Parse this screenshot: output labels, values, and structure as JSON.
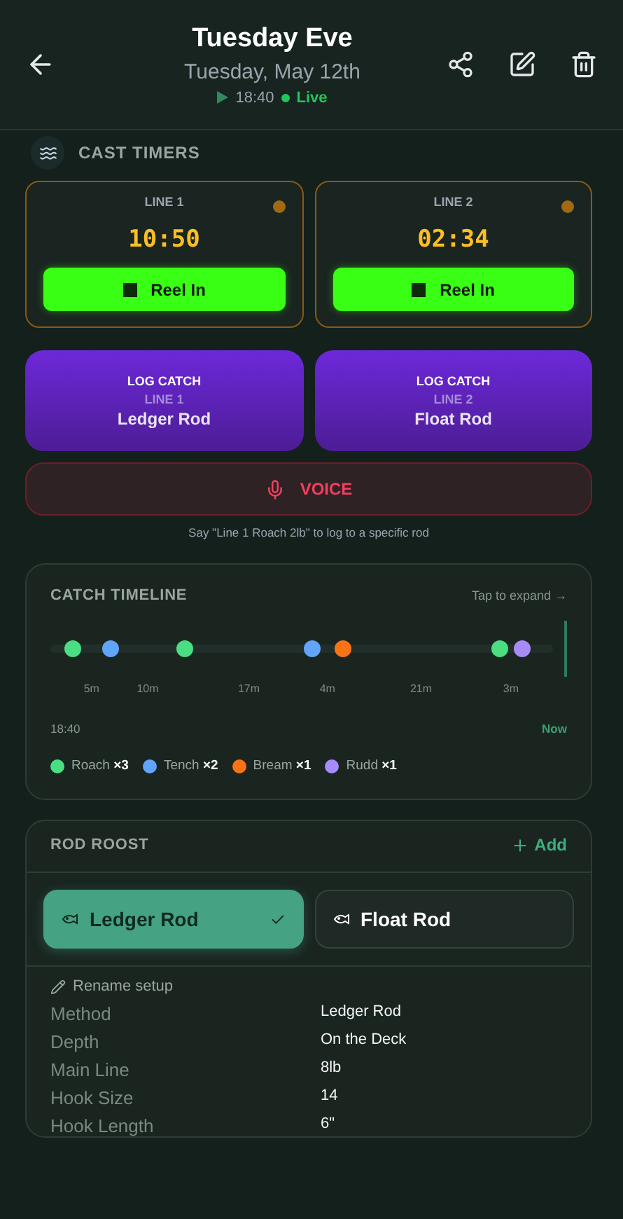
{
  "header": {
    "title": "Tuesday Eve",
    "date": "Tuesday, May 12th",
    "start_time": "18:40",
    "status": "Live",
    "live": true
  },
  "cast_timers": {
    "title": "CAST TIMERS",
    "timers": [
      {
        "line": "LINE 1",
        "time": "10:50",
        "running": true,
        "button": "Reel In"
      },
      {
        "line": "LINE 2",
        "time": "02:34",
        "running": true,
        "button": "Reel In"
      }
    ]
  },
  "log_buttons": [
    {
      "action": "LOG CATCH",
      "line": "LINE 1",
      "rod": "Ledger Rod"
    },
    {
      "action": "LOG CATCH",
      "line": "LINE 2",
      "rod": "Float Rod"
    }
  ],
  "voice": {
    "label": "VOICE",
    "hint": "Say \"Line 1 Roach 2lb\" to log to a specific rod"
  },
  "timeline": {
    "title": "CATCH TIMELINE",
    "expand": "Tap to expand →",
    "start": "18:40",
    "end": "Now",
    "catches": [
      {
        "color": "#4ade80"
      },
      {
        "color": "#60a5fa"
      },
      {
        "color": "#4ade80"
      },
      {
        "color": "#60a5fa"
      },
      {
        "color": "#f97316"
      },
      {
        "color": "#4ade80"
      },
      {
        "color": "#a78bfa"
      }
    ],
    "gaps": [
      "5m",
      "10m",
      "17m",
      "4m",
      "21m",
      "3m"
    ],
    "legend": [
      {
        "name": "Roach",
        "count": "×3",
        "color": "#4ade80"
      },
      {
        "name": "Tench",
        "count": "×2",
        "color": "#60a5fa"
      },
      {
        "name": "Bream",
        "count": "×1",
        "color": "#f97316"
      },
      {
        "name": "Rudd",
        "count": "×1",
        "color": "#a78bfa"
      }
    ]
  },
  "rod_roost": {
    "title": "ROD ROOST",
    "add": "Add",
    "rods": [
      {
        "name": "Ledger Rod",
        "selected": true
      },
      {
        "name": "Float Rod",
        "selected": false
      }
    ],
    "rename": "Rename setup",
    "details": [
      {
        "label": "Method",
        "value": "Ledger Rod"
      },
      {
        "label": "Depth",
        "value": "On the Deck"
      },
      {
        "label": "Main Line",
        "value": "8lb"
      },
      {
        "label": "Hook Size",
        "value": "14"
      },
      {
        "label": "Hook Length",
        "value": "6\""
      }
    ]
  }
}
